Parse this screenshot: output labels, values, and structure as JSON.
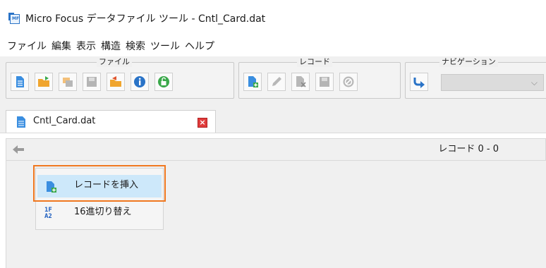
{
  "window": {
    "title": "Micro Focus データファイル ツール - Cntl_Card.dat",
    "logo_text": "MF"
  },
  "menu": [
    "ファイル",
    "編集",
    "表示",
    "構造",
    "検索",
    "ツール",
    "ヘルプ"
  ],
  "toolbar": {
    "groups": [
      {
        "label": "ファイル",
        "buttons": [
          "new-file-icon",
          "open-folder-icon",
          "open-structure-icon",
          "save-icon",
          "close-folder-icon",
          "info-icon",
          "unlock-icon"
        ]
      },
      {
        "label": "レコード",
        "buttons": [
          "insert-record-icon",
          "edit-pencil-icon",
          "delete-record-icon",
          "save-record-icon",
          "cancel-icon"
        ]
      },
      {
        "label": "ナビゲーション",
        "buttons": [
          "goto-icon"
        ],
        "select_value": ""
      }
    ]
  },
  "tabs": [
    {
      "label": "Cntl_Card.dat",
      "icon": "document-icon",
      "active": true
    }
  ],
  "record_bar": {
    "record_label": "レコード 0 - 0"
  },
  "context_menu": {
    "items": [
      {
        "label": "レコードを挿入",
        "icon": "insert-record-icon",
        "highlighted": true
      },
      {
        "label": "16進切り替え",
        "icon": "hex-toggle-icon",
        "icon_text_top": "1F",
        "icon_text_bottom": "A2"
      }
    ]
  },
  "colors": {
    "accent": "#2a73c7",
    "highlight_border": "#f07820",
    "menu_hover": "#cde8fa",
    "close_red": "#e03c3c"
  }
}
